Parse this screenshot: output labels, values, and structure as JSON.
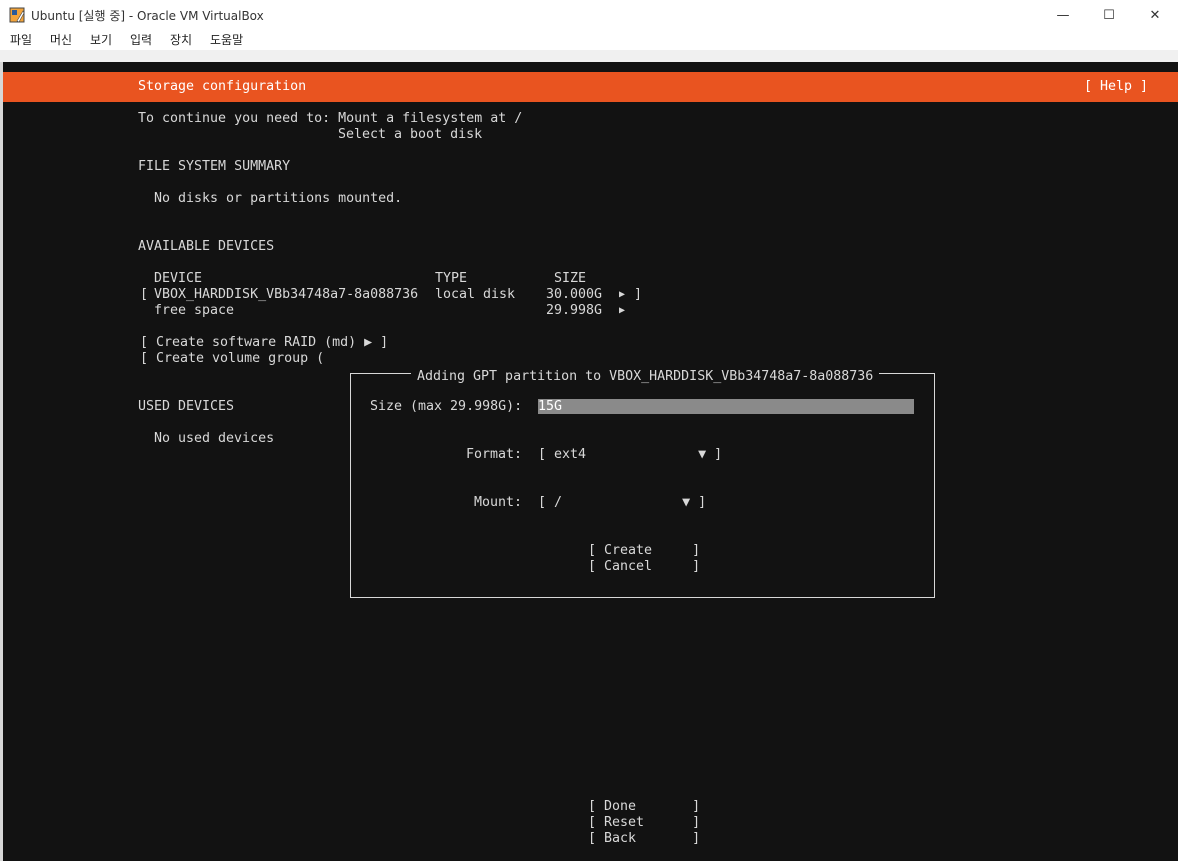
{
  "window": {
    "title": "Ubuntu [실행 중] - Oracle VM VirtualBox",
    "minimize": "—",
    "maximize": "☐",
    "close": "✕"
  },
  "menu": [
    "파일",
    "머신",
    "보기",
    "입력",
    "장치",
    "도움말"
  ],
  "installer": {
    "header": "Storage configuration",
    "help": "[ Help ]",
    "continue_line1": "To continue you need to: Mount a filesystem at /",
    "continue_line2": "Select a boot disk",
    "fs_summary_heading": "FILE SYSTEM SUMMARY",
    "fs_summary_empty": "No disks or partitions mounted.",
    "available_heading": "AVAILABLE DEVICES",
    "col_device": "DEVICE",
    "col_type": "TYPE",
    "col_size": "SIZE",
    "disk_row": {
      "open": "[",
      "name": "VBOX_HARDDISK_VBb34748a7-8a088736",
      "type": "local disk",
      "size": "30.000G",
      "arrow": "▶",
      "close": "]"
    },
    "free_row": {
      "name": "free space",
      "size": "29.998G",
      "arrow": "▶"
    },
    "raid_action": "[ Create software RAID (md) ▶ ]",
    "vg_action": "[ Create volume group (",
    "used_heading": "USED DEVICES",
    "used_empty": "No used devices",
    "done": "[ Done       ]",
    "reset": "[ Reset      ]",
    "back": "[ Back       ]"
  },
  "dialog": {
    "title": "Adding GPT partition to VBOX_HARDDISK_VBb34748a7-8a088736",
    "size_label": "Size (max 29.998G):",
    "size_value": "15G",
    "format_label": "Format:",
    "format_value": "[ ext4              ▼ ]",
    "mount_label": "Mount:",
    "mount_value": "[ /               ▼ ]",
    "create": "[ Create     ]",
    "cancel": "[ Cancel     ]"
  },
  "colors": {
    "accent": "#e95420",
    "terminal_bg": "#121212",
    "terminal_text": "#d8d8d8",
    "input_bg": "#8a8a8a"
  },
  "icons": [
    "virtualbox-icon",
    "minimize-icon",
    "maximize-icon",
    "close-icon"
  ]
}
